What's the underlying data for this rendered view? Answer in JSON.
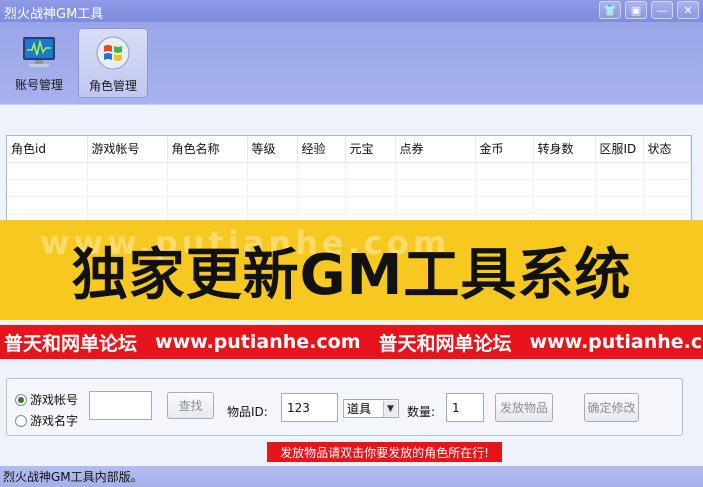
{
  "window": {
    "title": "烈火战神GM工具",
    "buttons": [
      "shirt",
      "menu",
      "minimize",
      "close"
    ]
  },
  "toolbar": {
    "account_label": "账号管理",
    "role_label": "角色管理"
  },
  "grid": {
    "columns": [
      "角色id",
      "游戏帐号",
      "角色名称",
      "等级",
      "经验",
      "元宝",
      "点券",
      "金币",
      "转身数",
      "区服ID",
      "状态"
    ]
  },
  "banner": {
    "headline": "独家更新GM工具系统",
    "watermark": "www.putianhe.com",
    "ribbon": [
      "普天和网单论坛",
      "www.putianhe.com",
      "普天和网单论坛",
      "www.putianhe.com"
    ]
  },
  "search": {
    "radio_account": "游戏帐号",
    "radio_name": "游戏名字",
    "selected": "游戏帐号",
    "query_value": "",
    "search_button": "查找"
  },
  "item": {
    "id_label": "物品ID:",
    "id_value": "123",
    "type_value": "道具",
    "qty_label": "数量:",
    "qty_value": "1",
    "send_button": "发放物品",
    "confirm_button": "确定修改"
  },
  "warning": "发放物品请双击你要发放的角色所在行!",
  "status": "烈火战神GM工具内部版。",
  "colors": {
    "window": "#9aa6e8",
    "banner_yellow": "#f7c81f",
    "banner_red": "#e8141c"
  }
}
